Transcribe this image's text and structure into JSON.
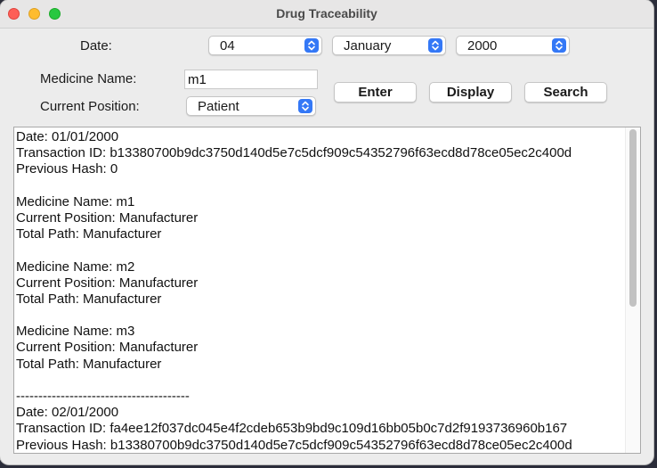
{
  "window": {
    "title": "Drug Traceability"
  },
  "form": {
    "date_label": "Date:",
    "day": "04",
    "month": "January",
    "year": "2000",
    "medicine_label": "Medicine Name:",
    "medicine_value": "m1",
    "position_label": "Current Position:",
    "position_value": "Patient"
  },
  "buttons": {
    "enter": "Enter",
    "display": "Display",
    "search": "Search"
  },
  "output": {
    "lines": [
      "Date: 01/01/2000",
      "Transaction ID: b13380700b9dc3750d140d5e7c5dcf909c54352796f63ecd8d78ce05ec2c400d",
      "Previous Hash: 0",
      "",
      "Medicine Name: m1",
      "Current Position: Manufacturer",
      "Total Path: Manufacturer",
      "",
      "Medicine Name: m2",
      "Current Position: Manufacturer",
      "Total Path: Manufacturer",
      "",
      "Medicine Name: m3",
      "Current Position: Manufacturer",
      "Total Path: Manufacturer",
      "",
      "---------------------------------------",
      "Date: 02/01/2000",
      "Transaction ID: fa4ee12f037dc045e4f2cdeb653b9bd9c109d16bb05b0c7d2f9193736960b167",
      "Previous Hash: b13380700b9dc3750d140d5e7c5dcf909c54352796f63ecd8d78ce05ec2c400d"
    ]
  },
  "scroll": {
    "visible_fraction": 0.55
  },
  "colors": {
    "accent": "#3478f6",
    "close": "#fe5f57",
    "minimize": "#febc2e",
    "maximize": "#28c840"
  },
  "icons": {
    "close": "close-icon",
    "minimize": "minimize-icon",
    "maximize": "maximize-icon",
    "select_arrows": "chevron-updown-icon"
  }
}
